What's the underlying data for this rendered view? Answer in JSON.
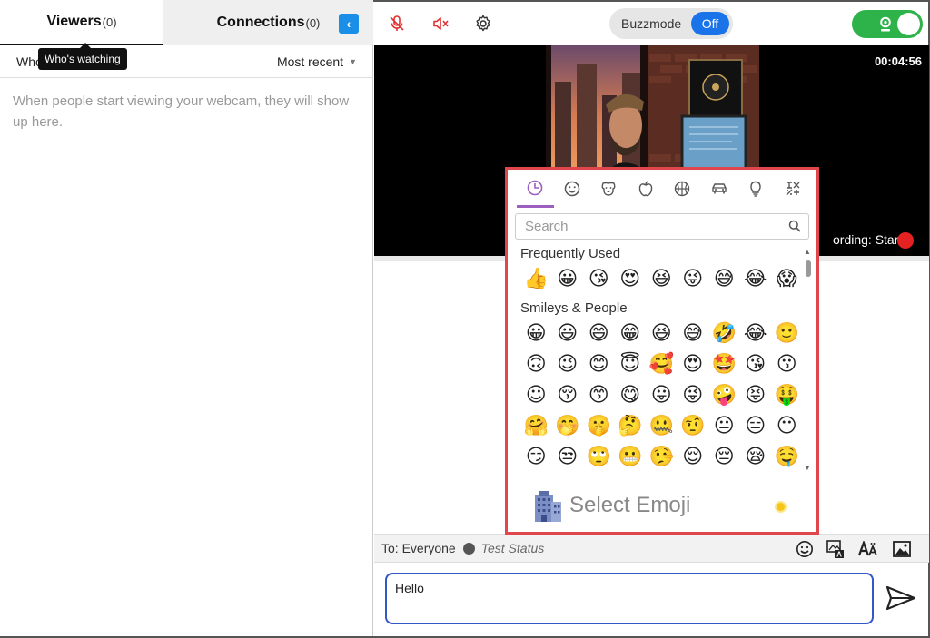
{
  "tabs": {
    "viewers_label": "Viewers",
    "viewers_count": "(0)",
    "connections_label": "Connections",
    "connections_count": "(0)"
  },
  "tooltip": "Who's watching",
  "filter": {
    "left_label": "Who",
    "sort_value": "Most recent"
  },
  "viewers_empty": "When people start viewing your webcam, they will show up here.",
  "toolbar": {
    "collapse_icon": "chevron-left-icon",
    "mic_icon": "mic-muted-icon",
    "speaker_icon": "speaker-muted-icon",
    "settings_icon": "gear-icon",
    "buzzmode_label": "Buzzmode",
    "buzzmode_state": "Off",
    "camera_icon": "webcam-icon"
  },
  "video": {
    "timer": "00:04:56",
    "recording_label": "ording: Start"
  },
  "picker": {
    "categories": [
      "recent-icon",
      "smiley-icon",
      "animal-icon",
      "food-icon",
      "activity-icon",
      "travel-icon",
      "objects-icon",
      "symbols-icon"
    ],
    "search_placeholder": "Search",
    "frequent_title": "Frequently Used",
    "frequent": [
      "👍",
      "😀",
      "😘",
      "😍",
      "😆",
      "😜",
      "😅",
      "😂",
      "😱"
    ],
    "smileys_title": "Smileys & People",
    "smileys": [
      [
        "😀",
        "😃",
        "😄",
        "😁",
        "😆",
        "😅",
        "🤣",
        "😂",
        "🙂"
      ],
      [
        "🙃",
        "😉",
        "😊",
        "😇",
        "🥰",
        "😍",
        "🤩",
        "😘",
        "😗"
      ],
      [
        "☺",
        "😚",
        "😙",
        "😋",
        "😛",
        "😜",
        "🤪",
        "😝",
        "🤑"
      ],
      [
        "🤗",
        "🤭",
        "🤫",
        "🤔",
        "🤐",
        "🤨",
        "😐",
        "😑",
        "😶"
      ],
      [
        "😏",
        "😒",
        "🙄",
        "😬",
        "🤥",
        "😌",
        "😔",
        "😪",
        "🤤"
      ]
    ],
    "preview_label": "Select Emoji",
    "preview_icon": "office-building-icon",
    "colors": {
      "border": "#e0474c",
      "active_tab": "#9b5fc0"
    }
  },
  "status": {
    "to_label": "To: Everyone",
    "status_text": "Test Status",
    "icons": [
      "emoji-icon",
      "text-image-icon",
      "font-size-icon",
      "image-icon"
    ]
  },
  "chat": {
    "message_value": "Hello",
    "send_icon": "send-icon"
  },
  "colors": {
    "accent": "#1a73e8",
    "camera_on": "#2db34a",
    "record": "#e52222"
  }
}
